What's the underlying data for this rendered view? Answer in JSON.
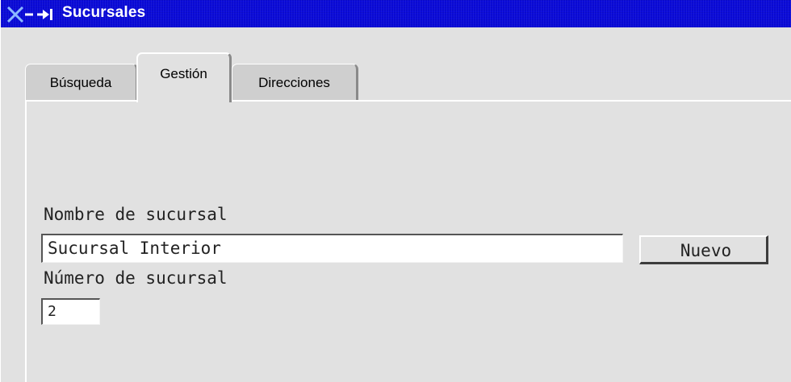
{
  "window": {
    "title": "Sucursales",
    "system_icon": "window-menu-icon",
    "colors": {
      "titlebar": "#0a0ad8",
      "background": "#e1e1e1"
    }
  },
  "tabs": [
    {
      "label": "Búsqueda",
      "active": false
    },
    {
      "label": "Gestión",
      "active": true
    },
    {
      "label": "Direcciones",
      "active": false
    }
  ],
  "form": {
    "nombre_label": "Nombre de sucursal",
    "nombre_value": "Sucursal Interior",
    "nuevo_button": "Nuevo",
    "numero_label": "Número de sucursal",
    "numero_value": "2"
  }
}
